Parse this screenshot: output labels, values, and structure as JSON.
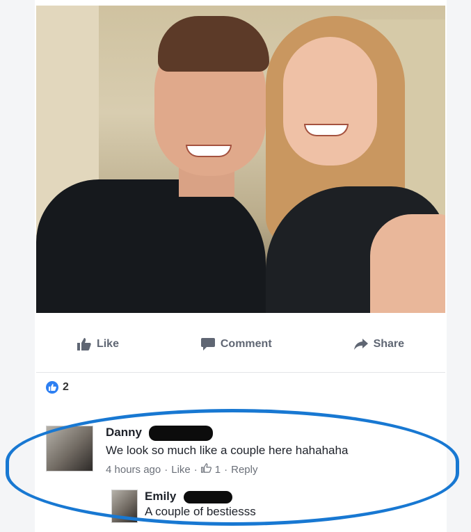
{
  "post": {
    "actions": {
      "like": "Like",
      "comment": "Comment",
      "share": "Share"
    },
    "reaction_count": "2"
  },
  "comments": [
    {
      "author": "Danny",
      "text": "We look so much like a couple here hahahaha",
      "time": "4 hours ago",
      "like_link": "Like",
      "like_count": "1",
      "reply_link": "Reply",
      "separator": "·"
    },
    {
      "author": "Emily",
      "text": "A couple of bestiesss"
    }
  ],
  "colors": {
    "highlight_ring": "#1878d2",
    "like_blue": "#2d7ff2",
    "redaction": "#0c0c0c"
  }
}
